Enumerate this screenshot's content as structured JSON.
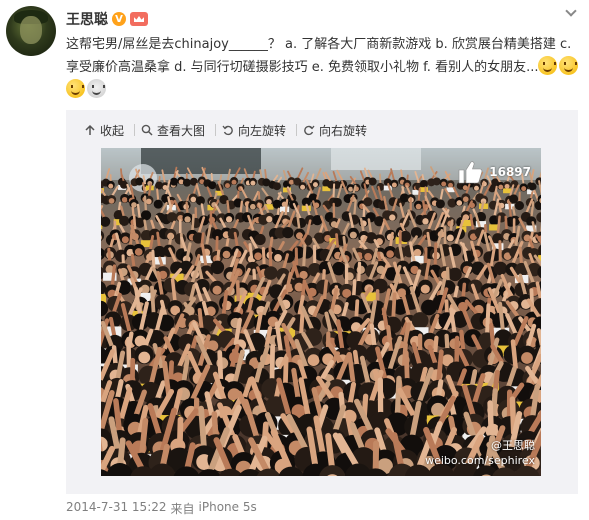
{
  "user": {
    "name": "王思聪",
    "verified_badge": "V"
  },
  "post": {
    "text": "这帮宅男/屌丝是去chinajoy______？ a. 了解各大厂商新款游戏 b. 欣赏展台精美搭建 c. 享受廉价高温桑拿 d. 与同行切磋摄影技巧 e. 免费领取小礼物 f. 看别人的女朋友...",
    "emojis": [
      "smile-emoji",
      "smile-emoji",
      "smile-emoji",
      "bear-emoji"
    ]
  },
  "toolbar": {
    "collapse": "收起",
    "view_large": "查看大图",
    "rotate_left": "向左旋转",
    "rotate_right": "向右旋转"
  },
  "image": {
    "like_count": "16897",
    "watermark_user": "@王思聪",
    "watermark_url": "weibo.com/sephirex"
  },
  "footer": {
    "timestamp": "2014-7-31 15:22",
    "from_label": "来自",
    "source": "iPhone 5s"
  },
  "colors": {
    "text": "#333333",
    "meta": "#808080",
    "media_bg": "#f2f2f5",
    "vip_badge": "#ffa21b"
  }
}
